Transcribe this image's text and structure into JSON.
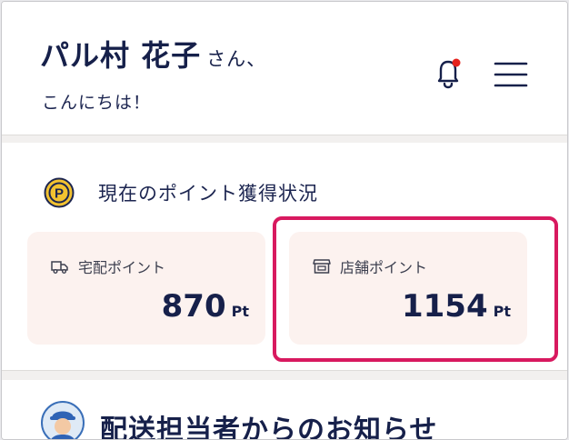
{
  "header": {
    "user_name": "パル村 花子",
    "honorific": "さん、",
    "greeting": "こんにちは！",
    "has_notification": true
  },
  "points": {
    "title": "現在のポイント獲得状況",
    "delivery": {
      "label": "宅配ポイント",
      "value": "870",
      "unit": "Pt"
    },
    "store": {
      "label": "店舗ポイント",
      "value": "1154",
      "unit": "Pt"
    }
  },
  "notice": {
    "title": "配送担当者からのお知らせ"
  },
  "colors": {
    "navy": "#16204a",
    "card_bg": "#fcf2ef",
    "highlight": "#d8195f",
    "coin": "#f2c230",
    "badge": "#e5211b"
  }
}
